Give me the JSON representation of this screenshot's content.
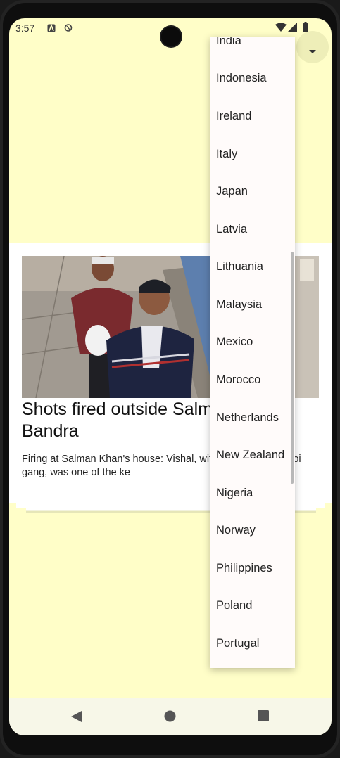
{
  "status_bar": {
    "time": "3:57",
    "icons": [
      "a-box-icon",
      "sync-icon",
      "wifi-icon",
      "signal-icon",
      "battery-icon"
    ]
  },
  "article": {
    "headline": "Shots fired outside Salman Khan's Bandra",
    "summary": "Firing at Salman Khan's house: Vishal, with Lawrence Bishnoi gang, was one of the ke"
  },
  "dropdown": {
    "icon": "caret-down-icon",
    "items": [
      "India",
      "Indonesia",
      "Ireland",
      "Italy",
      "Japan",
      "Latvia",
      "Lithuania",
      "Malaysia",
      "Mexico",
      "Morocco",
      "Netherlands",
      "New Zealand",
      "Nigeria",
      "Norway",
      "Philippines",
      "Poland",
      "Portugal"
    ]
  },
  "nav": {
    "back": "back-icon",
    "home": "home-icon",
    "recents": "recents-icon"
  },
  "colors": {
    "background": "#fffec8",
    "card": "#ffffff",
    "menu": "#fffbfa"
  }
}
